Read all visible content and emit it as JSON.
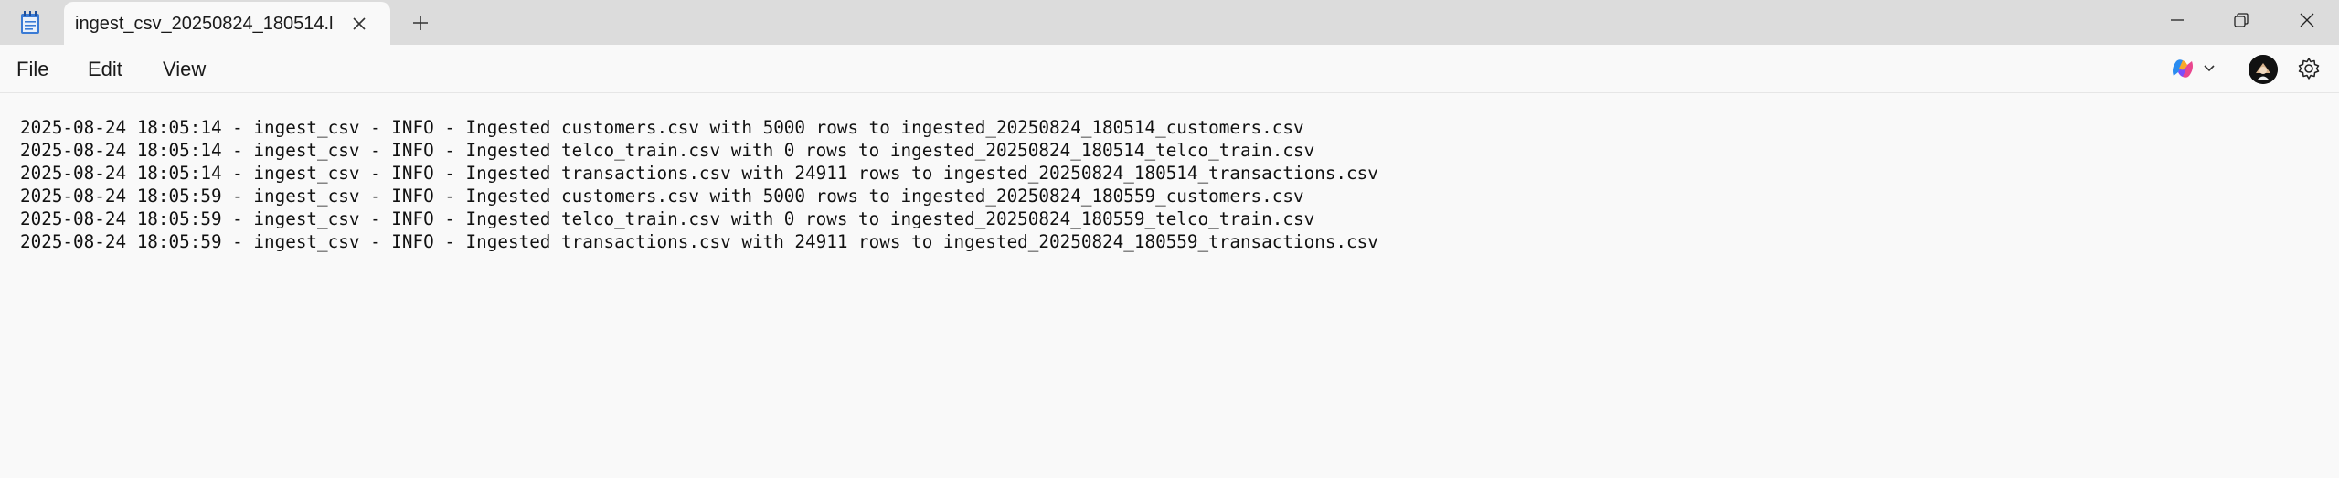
{
  "window": {
    "tab_title": "ingest_csv_20250824_180514.l",
    "icons": {
      "app": "notepad-icon",
      "close_tab": "close-icon",
      "new_tab": "plus-icon",
      "minimize": "minimize-icon",
      "maximize": "restore-icon",
      "close": "close-icon"
    }
  },
  "menu": {
    "file": "File",
    "edit": "Edit",
    "view": "View"
  },
  "toolbar_right": {
    "copilot": "copilot-icon",
    "copilot_dropdown": "chevron-down-icon",
    "account": "avatar",
    "settings": "gear-icon"
  },
  "editor": {
    "lines": [
      "2025-08-24 18:05:14 - ingest_csv - INFO - Ingested customers.csv with 5000 rows to ingested_20250824_180514_customers.csv",
      "2025-08-24 18:05:14 - ingest_csv - INFO - Ingested telco_train.csv with 0 rows to ingested_20250824_180514_telco_train.csv",
      "2025-08-24 18:05:14 - ingest_csv - INFO - Ingested transactions.csv with 24911 rows to ingested_20250824_180514_transactions.csv",
      "2025-08-24 18:05:59 - ingest_csv - INFO - Ingested customers.csv with 5000 rows to ingested_20250824_180559_customers.csv",
      "2025-08-24 18:05:59 - ingest_csv - INFO - Ingested telco_train.csv with 0 rows to ingested_20250824_180559_telco_train.csv",
      "2025-08-24 18:05:59 - ingest_csv - INFO - Ingested transactions.csv with 24911 rows to ingested_20250824_180559_transactions.csv"
    ]
  },
  "colors": {
    "titlebar_bg": "#dcdcdc",
    "content_bg": "#f9f9f9",
    "text": "#111111",
    "app_icon": "#2b6cb0"
  }
}
